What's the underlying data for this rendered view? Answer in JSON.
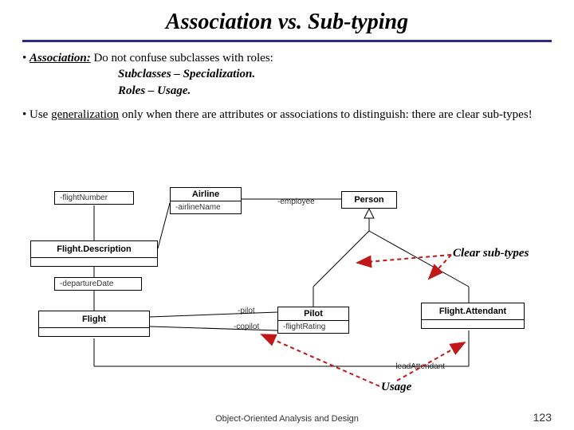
{
  "title": "Association vs. Sub-typing",
  "bullets": {
    "b1_label": "Association:",
    "b1_rest": " Do not confuse subclasses with roles:",
    "b1_line2": "Subclasses – Specialization.",
    "b1_line3": "Roles – Usage.",
    "b2_pre": "Use ",
    "b2_u": "generalization",
    "b2_post": " only when there are attributes or associations to distinguish: there are clear sub-types!"
  },
  "uml": {
    "flightDesc": {
      "title": "Flight.Description",
      "attr": "-flightNumber"
    },
    "airline": {
      "title": "Airline",
      "attr": "-airlineName"
    },
    "person": {
      "title": "Person"
    },
    "flight": {
      "title": "Flight",
      "attr": "-departureDate"
    },
    "pilot": {
      "title": "Pilot",
      "attr": "-flightRating"
    },
    "flightAttendant": {
      "title": "Flight.Attendant"
    }
  },
  "labels": {
    "employee": "-employee",
    "pilot": "-pilot",
    "copilot": "-copilot",
    "leadAttendant": "-leadAttendant"
  },
  "annotations": {
    "clear": "Clear sub-types",
    "usage": "Usage"
  },
  "footer": "Object-Oriented Analysis and Design",
  "page": "123"
}
